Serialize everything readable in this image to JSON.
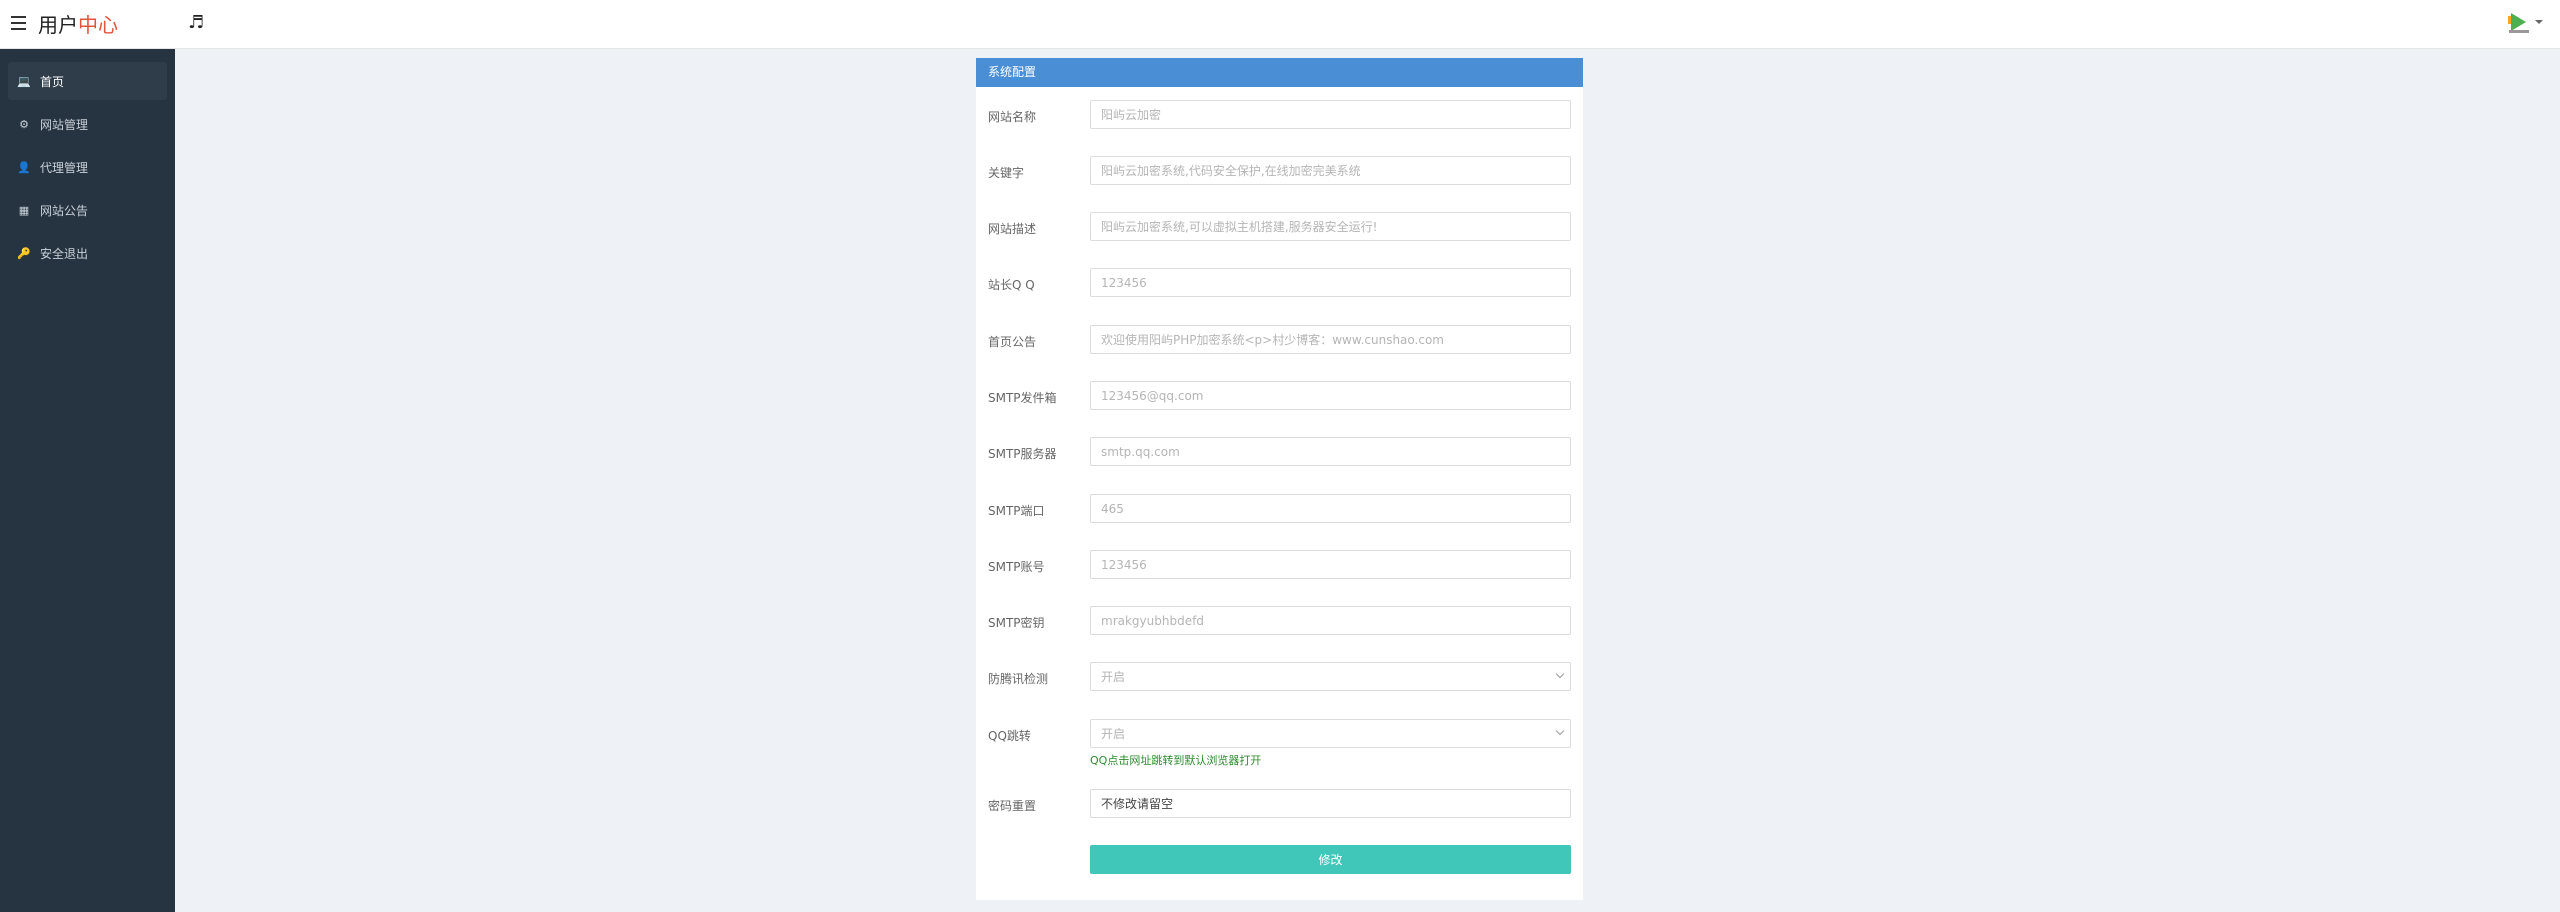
{
  "header": {
    "brand_part1": "用户",
    "brand_part2": "中心",
    "music_icon": "music-note-icon",
    "avatar_icon": "avatar-icon"
  },
  "sidebar": {
    "items": [
      {
        "label": "首页",
        "icon": "laptop-icon",
        "glyph": "💻",
        "active": true
      },
      {
        "label": "网站管理",
        "icon": "gear-icon",
        "glyph": "⚙",
        "active": false
      },
      {
        "label": "代理管理",
        "icon": "user-icon",
        "glyph": "👤",
        "active": false
      },
      {
        "label": "网站公告",
        "icon": "grid-icon",
        "glyph": "▦",
        "active": false
      },
      {
        "label": "安全退出",
        "icon": "key-icon",
        "glyph": "🔑",
        "active": false
      }
    ]
  },
  "panel": {
    "title": "系统配置",
    "fields": [
      {
        "label": "网站名称",
        "placeholder": "阳屿云加密",
        "value": ""
      },
      {
        "label": "关键字",
        "placeholder": "阳屿云加密系统,代码安全保护,在线加密完美系统",
        "value": ""
      },
      {
        "label": "网站描述",
        "placeholder": "阳屿云加密系统,可以虚拟主机搭建,服务器安全运行!",
        "value": ""
      },
      {
        "label": "站长Q Q",
        "placeholder": "123456",
        "value": ""
      },
      {
        "label": "首页公告",
        "placeholder": "欢迎使用阳屿PHP加密系统<p>村少博客：www.cunshao.com",
        "value": ""
      },
      {
        "label": "SMTP发件箱",
        "placeholder": "123456@qq.com",
        "value": ""
      },
      {
        "label": "SMTP服务器",
        "placeholder": "smtp.qq.com",
        "value": ""
      },
      {
        "label": "SMTP端口",
        "placeholder": "465",
        "value": ""
      },
      {
        "label": "SMTP账号",
        "placeholder": "123456",
        "value": ""
      },
      {
        "label": "SMTP密钥",
        "placeholder": "mrakgyubhbdefd",
        "value": ""
      }
    ],
    "selects": [
      {
        "label": "防腾讯检测",
        "selected": "开启"
      },
      {
        "label": "QQ跳转",
        "selected": "开启",
        "hint": "QQ点击网址跳转到默认浏览器打开"
      }
    ],
    "password": {
      "label": "密码重置",
      "value": "不修改请留空"
    },
    "submit_label": "修改"
  }
}
